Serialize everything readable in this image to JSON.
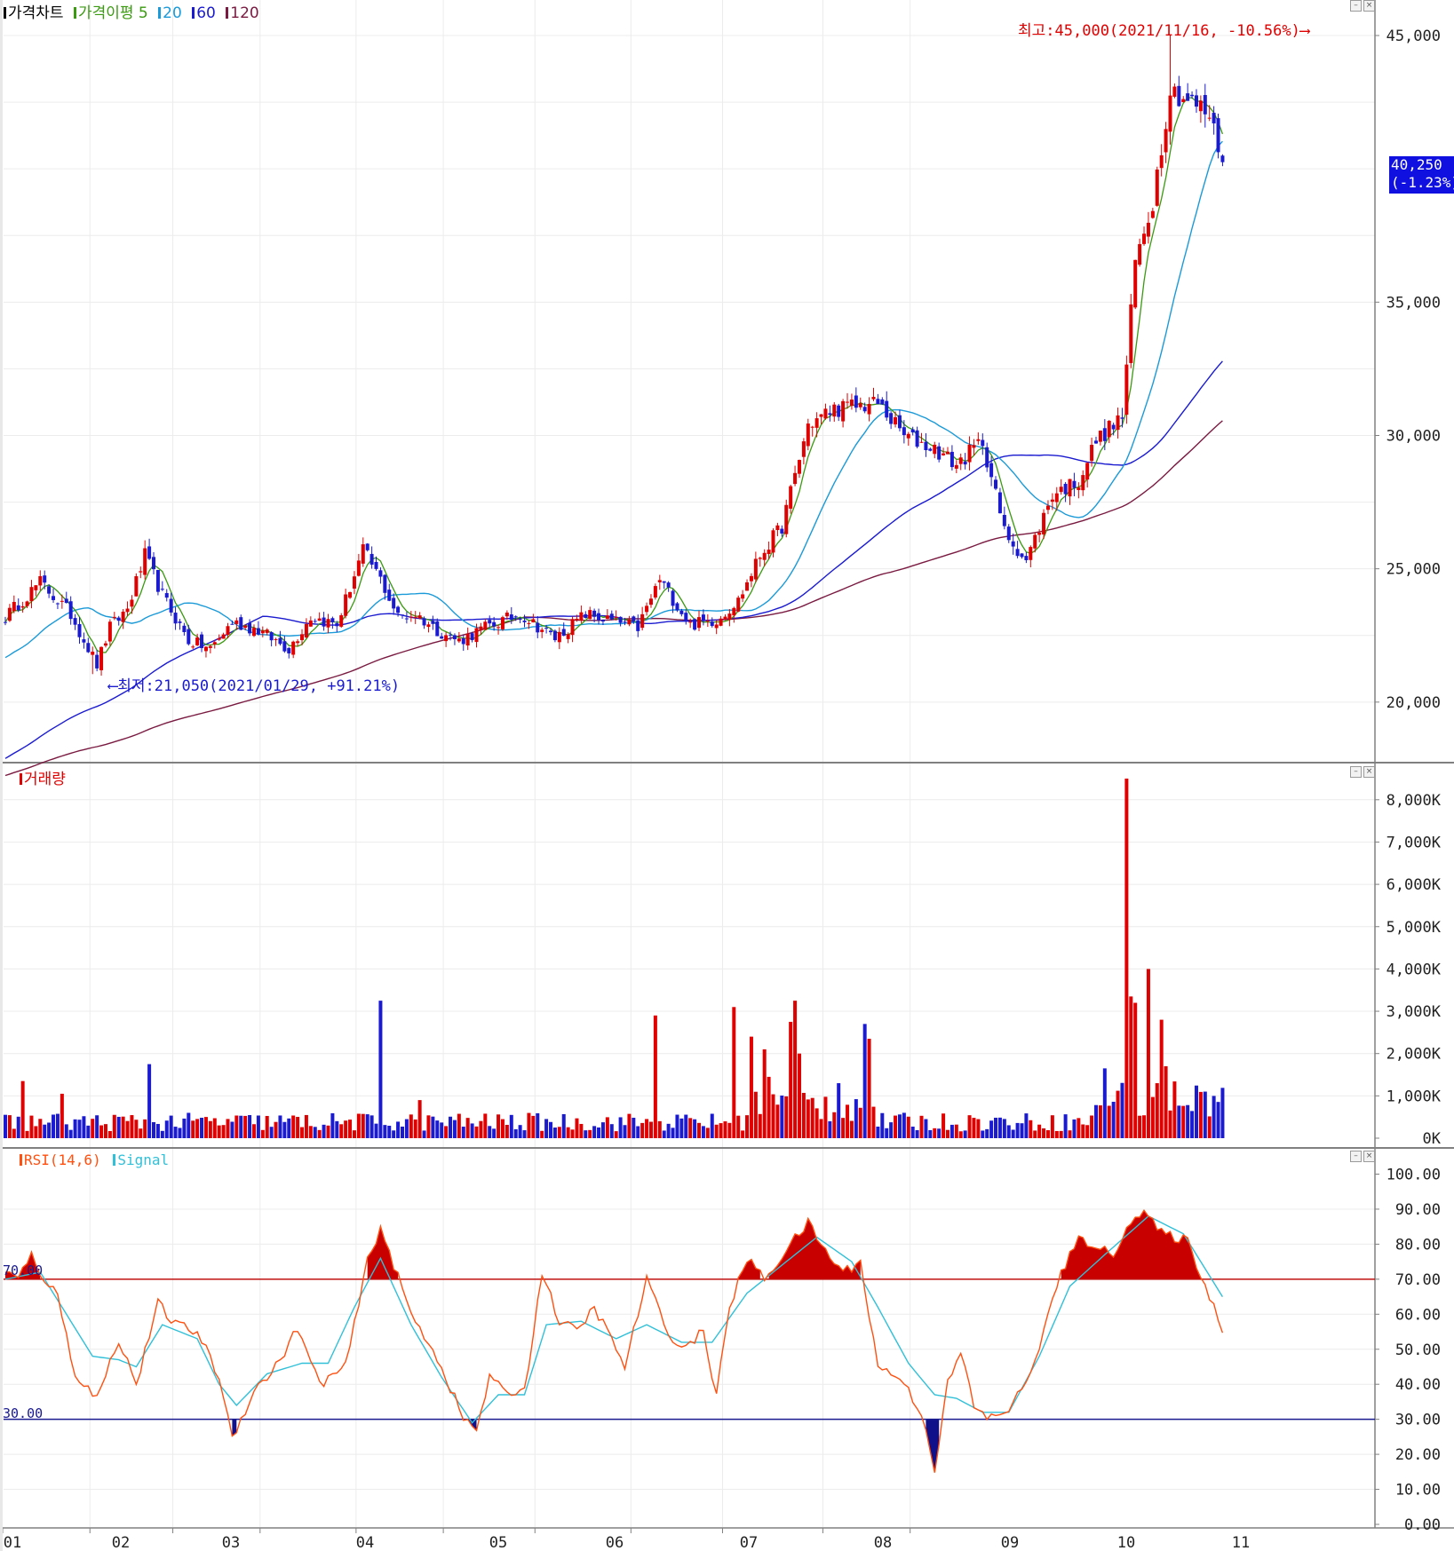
{
  "colors": {
    "up": "#e00000",
    "down": "#1a1ad0",
    "ma5": "#3a9a10",
    "ma20": "#1a9ad8",
    "ma60": "#1a1ad0",
    "ma120": "#7a1a40",
    "rsi": "#ff5010",
    "signal": "#30c0d8",
    "ob_line": "#c01010",
    "os_line": "#1a1a90",
    "fill_ob": "#c80000",
    "fill_os": "#10108a"
  },
  "price_panel": {
    "legend": [
      {
        "label": "가격차트",
        "color": "#000000"
      },
      {
        "label": "가격이평 5",
        "color": "#3a9a10"
      },
      {
        "label": "20",
        "color": "#1a9ad8"
      },
      {
        "label": "60",
        "color": "#1a1ad0"
      },
      {
        "label": "120",
        "color": "#7a1a40"
      }
    ],
    "y_ticks": [
      "45,000",
      "35,000",
      "30,000",
      "25,000",
      "20,000"
    ],
    "high_note": "최고:45,000(2021/11/16, -10.56%)⟶",
    "low_note": "⟵최저:21,050(2021/01/29, +91.21%)",
    "current_price": "40,250",
    "current_change": "(-1.23%)"
  },
  "volume_panel": {
    "legend": "거래량",
    "y_ticks": [
      "8,000K",
      "7,000K",
      "6,000K",
      "5,000K",
      "4,000K",
      "3,000K",
      "2,000K",
      "1,000K",
      "0K"
    ]
  },
  "rsi_panel": {
    "legend_rsi": "RSI(14,6)",
    "legend_signal": "Signal",
    "y_ticks": [
      "100.00",
      "90.00",
      "80.00",
      "70.00",
      "60.00",
      "50.00",
      "40.00",
      "30.00",
      "20.00",
      "10.00",
      "0.00"
    ],
    "level_70_label": "70.00",
    "level_30_label": "30.00"
  },
  "x_labels": [
    "01",
    "02",
    "03",
    "04",
    "05",
    "06",
    "07",
    "08",
    "09",
    "10",
    "11"
  ],
  "chart_data": [
    {
      "type": "candlestick",
      "title": "가격차트",
      "x_labels": [
        "01",
        "02",
        "03",
        "04",
        "05",
        "06",
        "07",
        "08",
        "09",
        "10",
        "11"
      ],
      "ylim": [
        18000,
        46500
      ],
      "price_knots": [
        [
          0,
          23200
        ],
        [
          8,
          24500
        ],
        [
          15,
          23300
        ],
        [
          21,
          21400
        ],
        [
          24,
          22800
        ],
        [
          28,
          23500
        ],
        [
          32,
          25500
        ],
        [
          36,
          24000
        ],
        [
          42,
          22300
        ],
        [
          47,
          22000
        ],
        [
          52,
          23000
        ],
        [
          58,
          22700
        ],
        [
          65,
          22000
        ],
        [
          70,
          23200
        ],
        [
          76,
          22900
        ],
        [
          82,
          25700
        ],
        [
          86,
          24600
        ],
        [
          90,
          23200
        ],
        [
          94,
          23300
        ],
        [
          99,
          22700
        ],
        [
          104,
          22300
        ],
        [
          110,
          22800
        ],
        [
          118,
          23300
        ],
        [
          126,
          22400
        ],
        [
          133,
          23300
        ],
        [
          140,
          23000
        ],
        [
          145,
          22800
        ],
        [
          150,
          24600
        ],
        [
          157,
          22900
        ],
        [
          163,
          23100
        ],
        [
          168,
          23800
        ],
        [
          173,
          25500
        ],
        [
          178,
          26600
        ],
        [
          184,
          30400
        ],
        [
          190,
          31000
        ],
        [
          200,
          31200
        ],
        [
          206,
          30000
        ],
        [
          213,
          29500
        ],
        [
          218,
          28900
        ],
        [
          224,
          29800
        ],
        [
          229,
          26400
        ],
        [
          234,
          25300
        ],
        [
          240,
          27800
        ],
        [
          246,
          28300
        ],
        [
          250,
          29800
        ],
        [
          256,
          30700
        ],
        [
          259,
          36500
        ],
        [
          263,
          38800
        ],
        [
          267,
          43000
        ],
        [
          272,
          42500
        ],
        [
          276,
          42000
        ],
        [
          279,
          40250
        ]
      ],
      "moving_averages": [
        5,
        20,
        60,
        120
      ],
      "high": {
        "value": 45000,
        "date": "2021/11/16",
        "change": "-10.56%"
      },
      "low": {
        "value": 21050,
        "date": "2021/01/29",
        "change": "+91.21%"
      },
      "last": {
        "value": 40250,
        "change": "-1.23%"
      }
    },
    {
      "type": "bar",
      "title": "거래량",
      "unit": "K",
      "ylim": [
        0,
        8700
      ],
      "baseline": 400,
      "spikes": [
        [
          4,
          1350
        ],
        [
          13,
          1050
        ],
        [
          33,
          1750
        ],
        [
          86,
          3250
        ],
        [
          95,
          900
        ],
        [
          149,
          2900
        ],
        [
          167,
          3100
        ],
        [
          171,
          2400
        ],
        [
          174,
          2100
        ],
        [
          175,
          1450
        ],
        [
          180,
          2750
        ],
        [
          181,
          3250
        ],
        [
          182,
          2000
        ],
        [
          191,
          1300
        ],
        [
          197,
          2700
        ],
        [
          198,
          2350
        ],
        [
          252,
          1650
        ],
        [
          257,
          8500
        ],
        [
          258,
          3350
        ],
        [
          259,
          3200
        ],
        [
          262,
          4000
        ],
        [
          264,
          1300
        ],
        [
          265,
          2800
        ],
        [
          266,
          1700
        ]
      ]
    },
    {
      "type": "line",
      "title": "RSI(14,6)",
      "series_names": [
        "RSI(14,6)",
        "Signal"
      ],
      "ylim": [
        0,
        100
      ],
      "levels": [
        70,
        30
      ],
      "rsi_knots": [
        [
          0,
          72
        ],
        [
          3,
          70
        ],
        [
          6,
          77
        ],
        [
          8,
          72
        ],
        [
          12,
          65
        ],
        [
          16,
          43
        ],
        [
          21,
          36
        ],
        [
          26,
          53
        ],
        [
          30,
          40
        ],
        [
          35,
          63
        ],
        [
          39,
          57
        ],
        [
          44,
          55
        ],
        [
          49,
          42
        ],
        [
          52,
          25
        ],
        [
          57,
          38
        ],
        [
          62,
          45
        ],
        [
          67,
          56
        ],
        [
          72,
          40
        ],
        [
          78,
          45
        ],
        [
          83,
          75
        ],
        [
          86,
          85
        ],
        [
          89,
          74
        ],
        [
          93,
          60
        ],
        [
          98,
          50
        ],
        [
          101,
          42
        ],
        [
          105,
          30
        ],
        [
          108,
          27
        ],
        [
          111,
          42
        ],
        [
          114,
          38
        ],
        [
          119,
          38
        ],
        [
          123,
          72
        ],
        [
          127,
          58
        ],
        [
          131,
          55
        ],
        [
          135,
          62
        ],
        [
          138,
          55
        ],
        [
          142,
          45
        ],
        [
          147,
          70
        ],
        [
          151,
          57
        ],
        [
          155,
          50
        ],
        [
          160,
          55
        ],
        [
          163,
          37
        ],
        [
          166,
          62
        ],
        [
          170,
          76
        ],
        [
          174,
          70
        ],
        [
          180,
          80
        ],
        [
          184,
          86
        ],
        [
          188,
          78
        ],
        [
          192,
          72
        ],
        [
          196,
          75
        ],
        [
          200,
          45
        ],
        [
          205,
          42
        ],
        [
          210,
          32
        ],
        [
          213,
          16
        ],
        [
          216,
          40
        ],
        [
          219,
          49
        ],
        [
          222,
          34
        ],
        [
          225,
          30
        ],
        [
          230,
          33
        ],
        [
          234,
          40
        ],
        [
          238,
          55
        ],
        [
          242,
          72
        ],
        [
          246,
          81
        ],
        [
          250,
          80
        ],
        [
          254,
          76
        ],
        [
          257,
          86
        ],
        [
          261,
          89
        ],
        [
          265,
          83
        ],
        [
          268,
          82
        ],
        [
          271,
          81
        ],
        [
          275,
          68
        ],
        [
          279,
          56
        ]
      ],
      "signal_knots": [
        [
          0,
          70
        ],
        [
          8,
          72
        ],
        [
          14,
          60
        ],
        [
          20,
          48
        ],
        [
          26,
          47
        ],
        [
          30,
          45
        ],
        [
          36,
          57
        ],
        [
          44,
          53
        ],
        [
          49,
          40
        ],
        [
          53,
          34
        ],
        [
          60,
          43
        ],
        [
          68,
          46
        ],
        [
          74,
          46
        ],
        [
          80,
          62
        ],
        [
          86,
          76
        ],
        [
          93,
          57
        ],
        [
          100,
          42
        ],
        [
          107,
          29
        ],
        [
          113,
          37
        ],
        [
          119,
          37
        ],
        [
          124,
          57
        ],
        [
          132,
          58
        ],
        [
          140,
          53
        ],
        [
          147,
          57
        ],
        [
          155,
          52
        ],
        [
          162,
          52
        ],
        [
          170,
          66
        ],
        [
          178,
          74
        ],
        [
          186,
          82
        ],
        [
          194,
          75
        ],
        [
          200,
          62
        ],
        [
          207,
          46
        ],
        [
          213,
          37
        ],
        [
          218,
          36
        ],
        [
          224,
          32
        ],
        [
          230,
          32
        ],
        [
          237,
          48
        ],
        [
          244,
          68
        ],
        [
          252,
          77
        ],
        [
          262,
          88
        ],
        [
          270,
          83
        ],
        [
          279,
          65
        ]
      ]
    }
  ]
}
